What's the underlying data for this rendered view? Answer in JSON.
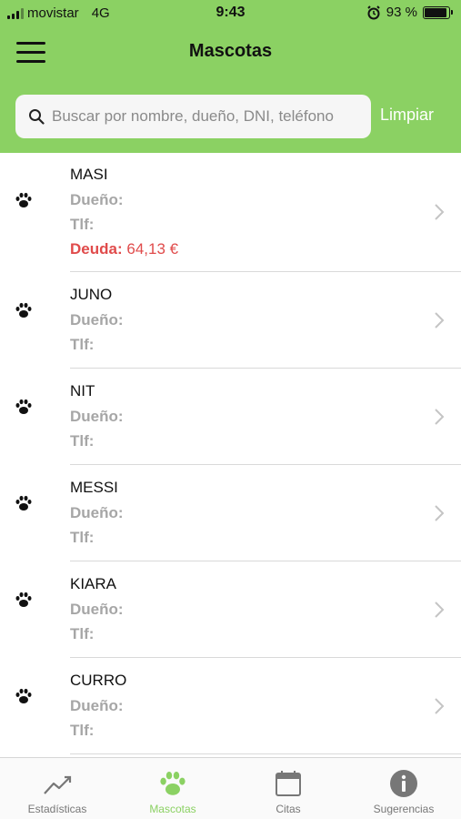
{
  "status_bar": {
    "carrier": "movistar",
    "network": "4G",
    "time": "9:43",
    "battery": "93 %"
  },
  "header": {
    "title": "Mascotas",
    "menu_icon": "hamburger-menu-icon",
    "accent_color": "#8bd163"
  },
  "search": {
    "placeholder": "Buscar por nombre, dueño, DNI, teléfono",
    "value": "",
    "clear_label": "Limpiar"
  },
  "list": {
    "owner_label": "Dueño:",
    "phone_label": "Tlf:",
    "debt_label": "Deuda:",
    "item_icon": "paw-icon",
    "items": [
      {
        "name": "MASI",
        "owner": "",
        "phone": "",
        "debt": "64,13 €"
      },
      {
        "name": "JUNO",
        "owner": "",
        "phone": ""
      },
      {
        "name": "NIT",
        "owner": "",
        "phone": ""
      },
      {
        "name": "MESSI",
        "owner": "",
        "phone": ""
      },
      {
        "name": "KIARA",
        "owner": "",
        "phone": ""
      },
      {
        "name": "CURRO",
        "owner": "",
        "phone": ""
      }
    ]
  },
  "tabs": [
    {
      "label": "Estadísticas",
      "icon": "chart-line-icon",
      "active": false
    },
    {
      "label": "Mascotas",
      "icon": "paw-icon",
      "active": true
    },
    {
      "label": "Citas",
      "icon": "calendar-icon",
      "active": false
    },
    {
      "label": "Sugerencias",
      "icon": "info-icon",
      "active": false
    }
  ]
}
